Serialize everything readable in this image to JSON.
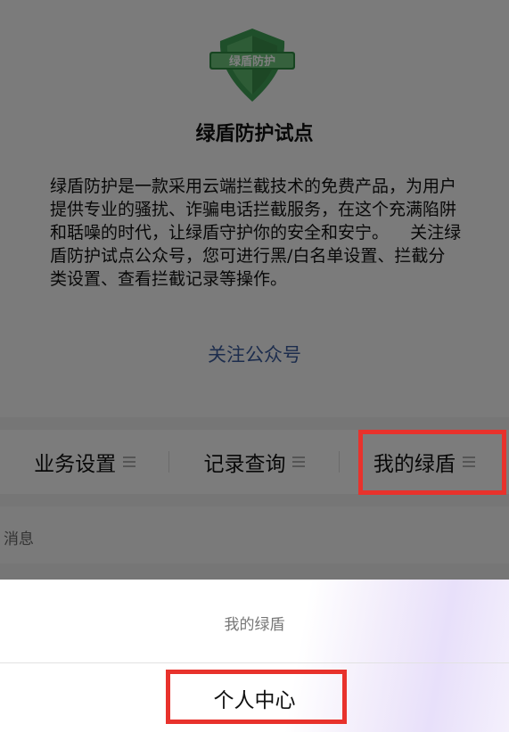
{
  "header": {
    "logo_text": "绿盾防护",
    "title": "绿盾防护试点",
    "description": "绿盾防护是一款采用云端拦截技术的免费产品，为用户提供专业的骚扰、诈骗电话拦截服务，在这个充满陷阱和聒噪的时代，让绿盾守护你的安全和安宁。    关注绿盾防护试点公众号，您可进行黑/白名单设置、拦截分类设置、查看拦截记录等操作。",
    "follow_link": "关注公众号"
  },
  "menubar": {
    "items": [
      {
        "label": "业务设置",
        "icon": "hamburger-icon"
      },
      {
        "label": "记录查询",
        "icon": "hamburger-icon"
      },
      {
        "label": "我的绿盾",
        "icon": "hamburger-icon"
      }
    ]
  },
  "messages": {
    "label": "消息"
  },
  "action_sheet": {
    "title": "我的绿盾",
    "options": [
      "个人中心"
    ]
  },
  "colors": {
    "accent_link": "#3b5a9a",
    "shield_green": "#3f9e54",
    "highlight_red": "#e8322c"
  }
}
